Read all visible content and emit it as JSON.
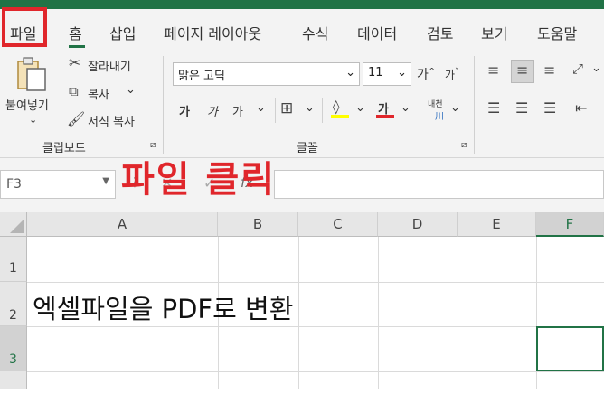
{
  "tabs": [
    "파일",
    "홈",
    "삽입",
    "페이지 레이아웃",
    "수식",
    "데이터",
    "검토",
    "보기",
    "도움말"
  ],
  "clipboard": {
    "paste_label": "붙여넣기",
    "cut_label": "잘라내기",
    "copy_label": "복사",
    "format_painter_label": "서식 복사",
    "group_label": "클립보드"
  },
  "font": {
    "font_name": "맑은 고딕",
    "font_size": "11",
    "grow_label": "가",
    "shrink_label": "가",
    "bold_label": "가",
    "italic_label": "가",
    "underline_label": "가",
    "font_color_label": "가",
    "phonetic_label": "내천",
    "group_label": "글꼴"
  },
  "annotation": "파일 클릭",
  "formula_bar": {
    "name_box": "F3"
  },
  "sheet": {
    "columns": [
      "A",
      "B",
      "C",
      "D",
      "E",
      "F"
    ],
    "rows": [
      "1",
      "2",
      "3"
    ],
    "cell_a2": "엑셀파일을 PDF로 변환",
    "selected_cell": "F3"
  },
  "colors": {
    "excel_green": "#217346",
    "annotation_red": "#e0262b",
    "font_color_bar": "#e0262b",
    "highlight_bar": "#ffff00"
  }
}
